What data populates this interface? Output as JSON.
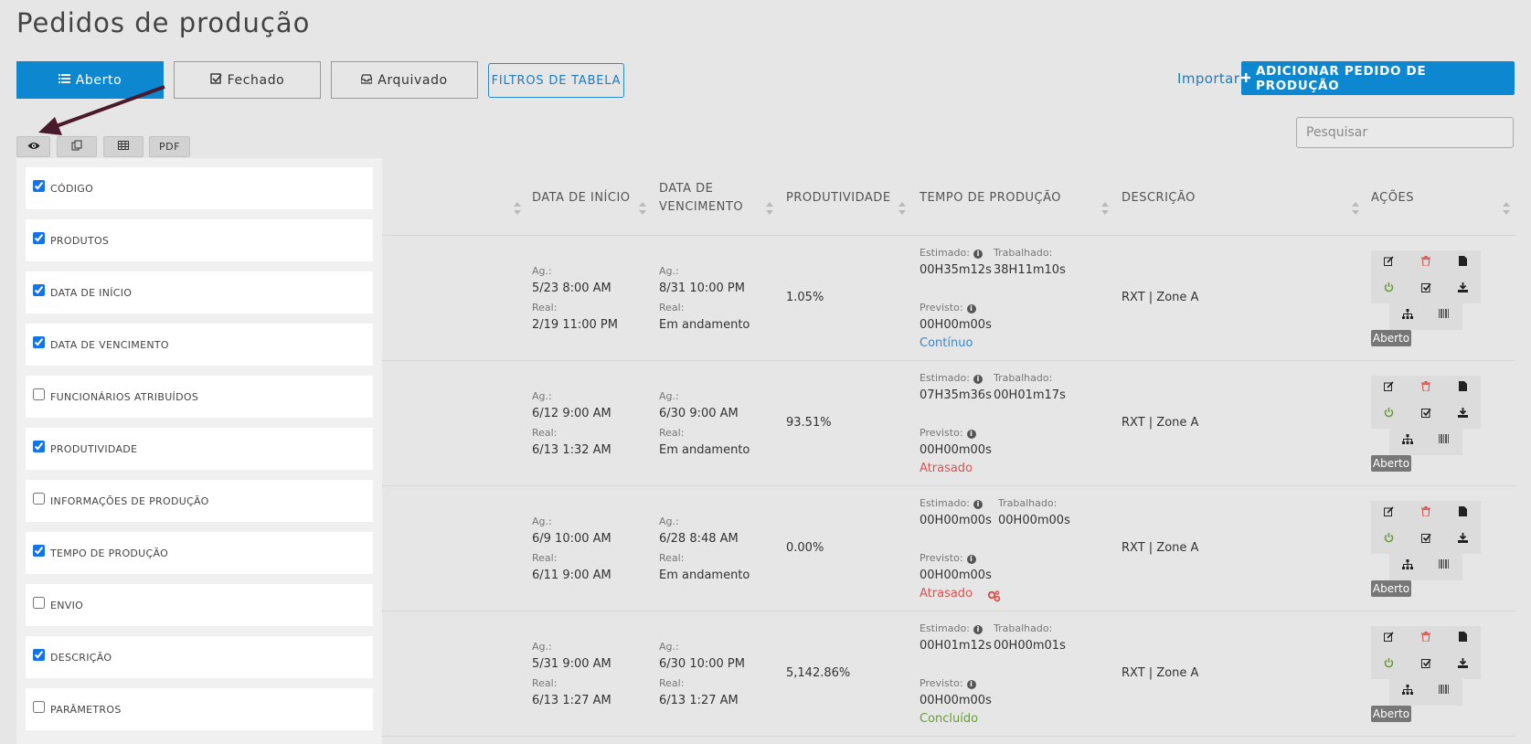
{
  "page_title": "Pedidos de produção",
  "tabs": [
    {
      "label": "Aberto",
      "icon": "list-icon",
      "active": true
    },
    {
      "label": "Fechado",
      "icon": "checkbox-icon",
      "active": false
    },
    {
      "label": "Arquivado",
      "icon": "inbox-icon",
      "active": false
    }
  ],
  "filter_button": "FILTROS DE TABELA",
  "import_link": "Importar",
  "add_button": "ADICIONAR PEDIDO DE PRODUÇÃO",
  "search": {
    "placeholder": "Pesquisar"
  },
  "toolbar": {
    "pdf": "PDF"
  },
  "column_panel": [
    {
      "label": "CÓDIGO",
      "checked": true
    },
    {
      "label": "PRODUTOS",
      "checked": true
    },
    {
      "label": "DATA DE INÍCIO",
      "checked": true
    },
    {
      "label": "DATA DE VENCIMENTO",
      "checked": true
    },
    {
      "label": "FUNCIONÁRIOS ATRIBUÍDOS",
      "checked": false
    },
    {
      "label": "PRODUTIVIDADE",
      "checked": true
    },
    {
      "label": "INFORMAÇÕES DE PRODUÇÃO",
      "checked": false
    },
    {
      "label": "TEMPO DE PRODUÇÃO",
      "checked": true
    },
    {
      "label": "ENVIO",
      "checked": false
    },
    {
      "label": "DESCRIÇÃO",
      "checked": true
    },
    {
      "label": "PARÂMETROS",
      "checked": false
    }
  ],
  "headers": {
    "start": "DATA DE INÍCIO",
    "due_1": "DATA DE",
    "due_2": "VENCIMENTO",
    "productivity": "PRODUTIVIDADE",
    "production_time": "TEMPO DE PRODUÇÃO",
    "description": "DESCRIÇÃO",
    "actions": "AÇÕES"
  },
  "labels": {
    "scheduled": "Ag.:",
    "real": "Real:",
    "estimated": "Estimado:",
    "worked": "Trabalhado:",
    "forecast": "Previsto:"
  },
  "rows": [
    {
      "start_sched": "5/23   8:00 AM",
      "start_real": "2/19   11:00 PM",
      "due_sched": "8/31   10:00 PM",
      "due_real": "Em andamento",
      "productivity": "1.05%",
      "estimated": "00H35m12s",
      "worked": "38H11m10s",
      "forecast": "00H00m00s",
      "status": "Contínuo",
      "status_type": "cont",
      "description": "RXT | Zone A",
      "badge": "Aberto"
    },
    {
      "start_sched": "6/12   9:00 AM",
      "start_real": "6/13   1:32 AM",
      "due_sched": "6/30   9:00 AM",
      "due_real": "Em andamento",
      "productivity": "93.51%",
      "estimated": "07H35m36s",
      "worked": "00H01m17s",
      "forecast": "00H00m00s",
      "status": "Atrasado",
      "status_type": "late",
      "description": "RXT | Zone A",
      "badge": "Aberto"
    },
    {
      "start_sched": "6/9   10:00 AM",
      "start_real": "6/11   9:00 AM",
      "due_sched": "6/28   8:48 AM",
      "due_real": "Em andamento",
      "productivity": "0.00%",
      "estimated": "00H00m00s",
      "worked": "00H00m00s",
      "forecast": "00H00m00s",
      "status": "Atrasado",
      "status_type": "late",
      "description": "RXT | Zone A",
      "badge": "Aberto"
    },
    {
      "start_sched": "5/31   9:00 AM",
      "start_real": "6/13   1:27 AM",
      "due_sched": "6/30   10:00 PM",
      "due_real": "6/13   1:27 AM",
      "productivity": "5,142.86%",
      "estimated": "00H01m12s",
      "worked": "00H00m01s",
      "forecast": "00H00m00s",
      "status": "Concluído",
      "status_type": "done",
      "description": "RXT | Zone A",
      "badge": "Aberto"
    }
  ],
  "colors": {
    "primary": "#0d87d0",
    "late": "#d9534f",
    "done": "#6a9e35",
    "continuous": "#3d87c5"
  }
}
